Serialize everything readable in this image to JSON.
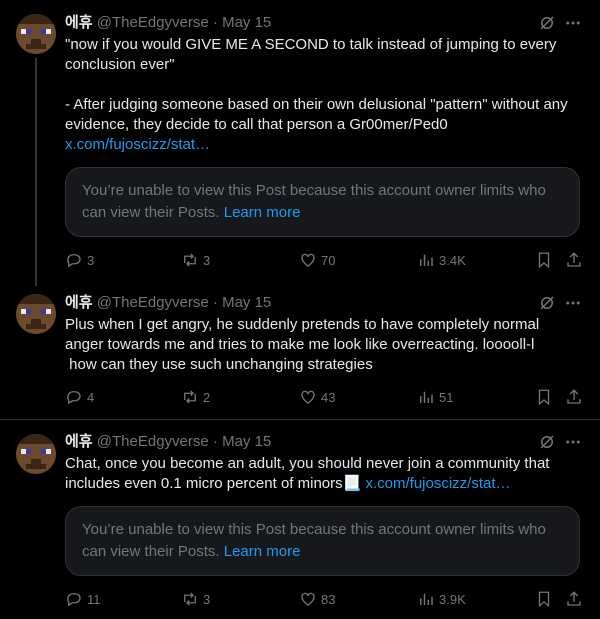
{
  "posts": [
    {
      "name": "에휴",
      "handle": "@TheEdgyverse",
      "dot": "·",
      "date": "May 15",
      "text": "\"now if you would GIVE ME A SECOND to talk instead of jumping to every conclusion ever\"\n\n- After judging someone based on their own delusional \"pattern\" without any evidence, they decide to call that person a Gr00mer/Ped0",
      "link": "x.com/fujoscizz/stat…",
      "card_text": "You’re unable to view this Post because this account owner limits who can view their Posts.",
      "card_link": "Learn more",
      "replies": "3",
      "reposts": "3",
      "likes": "70",
      "views": "3.4K"
    },
    {
      "name": "에휴",
      "handle": "@TheEdgyverse",
      "dot": "·",
      "date": "May 15",
      "text": "Plus when I get angry, he suddenly pretends to have completely normal anger towards me and tries to make me look like overreacting. looooll-l\n how can they use such unchanging strategies",
      "replies": "4",
      "reposts": "2",
      "likes": "43",
      "views": "51"
    },
    {
      "name": "에휴",
      "handle": "@TheEdgyverse",
      "dot": "·",
      "date": "May 15",
      "text": "Chat, once you become an adult, you should never join a community that includes even 0.1 micro percent of minors📃 ",
      "link": "x.com/fujoscizz/stat…",
      "card_text": "You’re unable to view this Post because this account owner limits who can view their Posts.",
      "card_link": "Learn more",
      "replies": "11",
      "reposts": "3",
      "likes": "83",
      "views": "3.9K"
    }
  ],
  "icons": {
    "reply": "reply-icon",
    "repost": "repost-icon",
    "like": "like-icon",
    "views": "views-icon",
    "bookmark": "bookmark-icon",
    "share": "share-icon",
    "grok": "grok-icon",
    "more": "more-icon"
  },
  "colors": {
    "background": "#000000",
    "text": "#e7e9ea",
    "secondary": "#71767b",
    "link": "#1d9bf0",
    "border": "#2f3336"
  }
}
